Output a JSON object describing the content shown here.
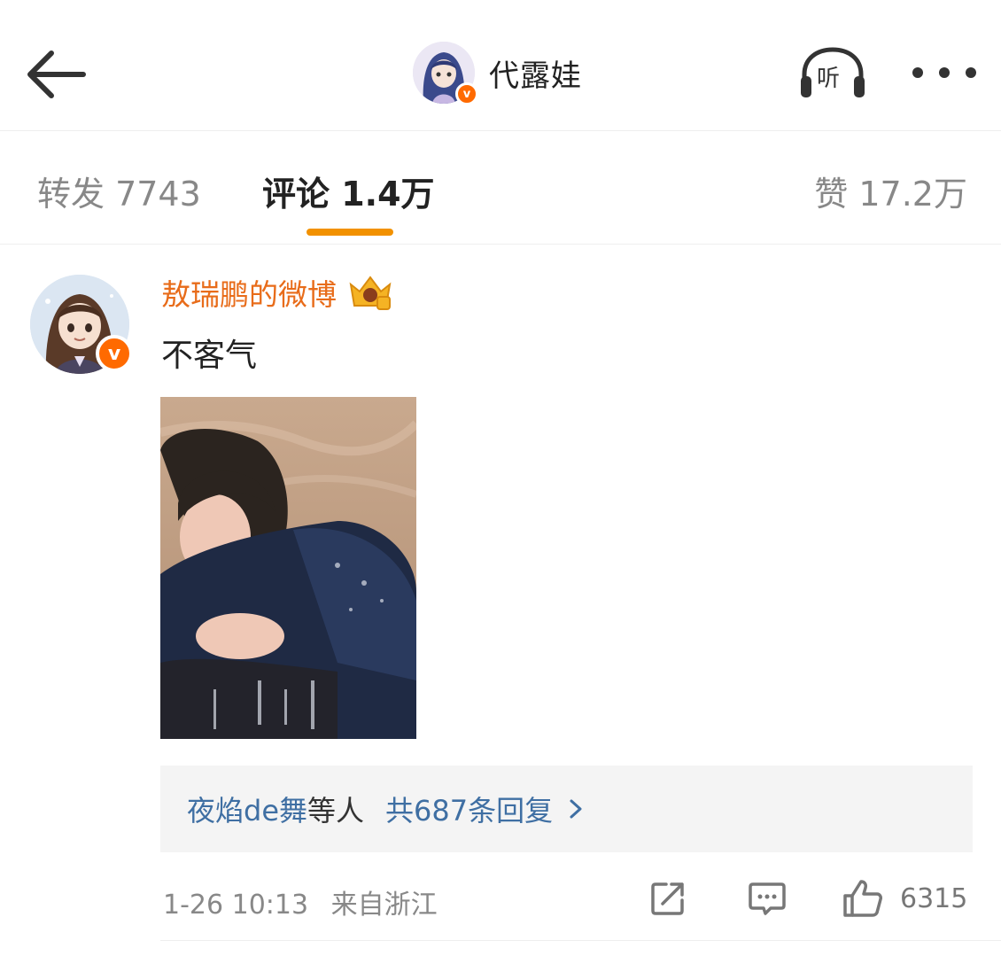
{
  "header": {
    "title": "代露娃",
    "verified_badge": "v",
    "listen_label": "听"
  },
  "tabs": {
    "repost": "转发 7743",
    "comment": "评论 1.4万",
    "like": "赞 17.2万"
  },
  "comment": {
    "username": "敖瑞鹏的微博",
    "verified_badge": "v",
    "text": "不客气",
    "replies": {
      "users": "夜焰de舞",
      "suffix": "等人",
      "count_text": "共687条回复"
    },
    "time": "1-26 10:13",
    "source": "来自浙江",
    "like_count": "6315"
  },
  "colors": {
    "accent_orange": "#f29100",
    "username_orange": "#e86c1a",
    "link_blue": "#3f6fa3",
    "verified_orange": "#ff6a00"
  },
  "icons": [
    "back-arrow-icon",
    "headphones-icon",
    "more-dots-icon",
    "crown-fan-badge-icon",
    "share-icon",
    "comment-icon",
    "thumbs-up-icon",
    "chevron-right-icon"
  ]
}
